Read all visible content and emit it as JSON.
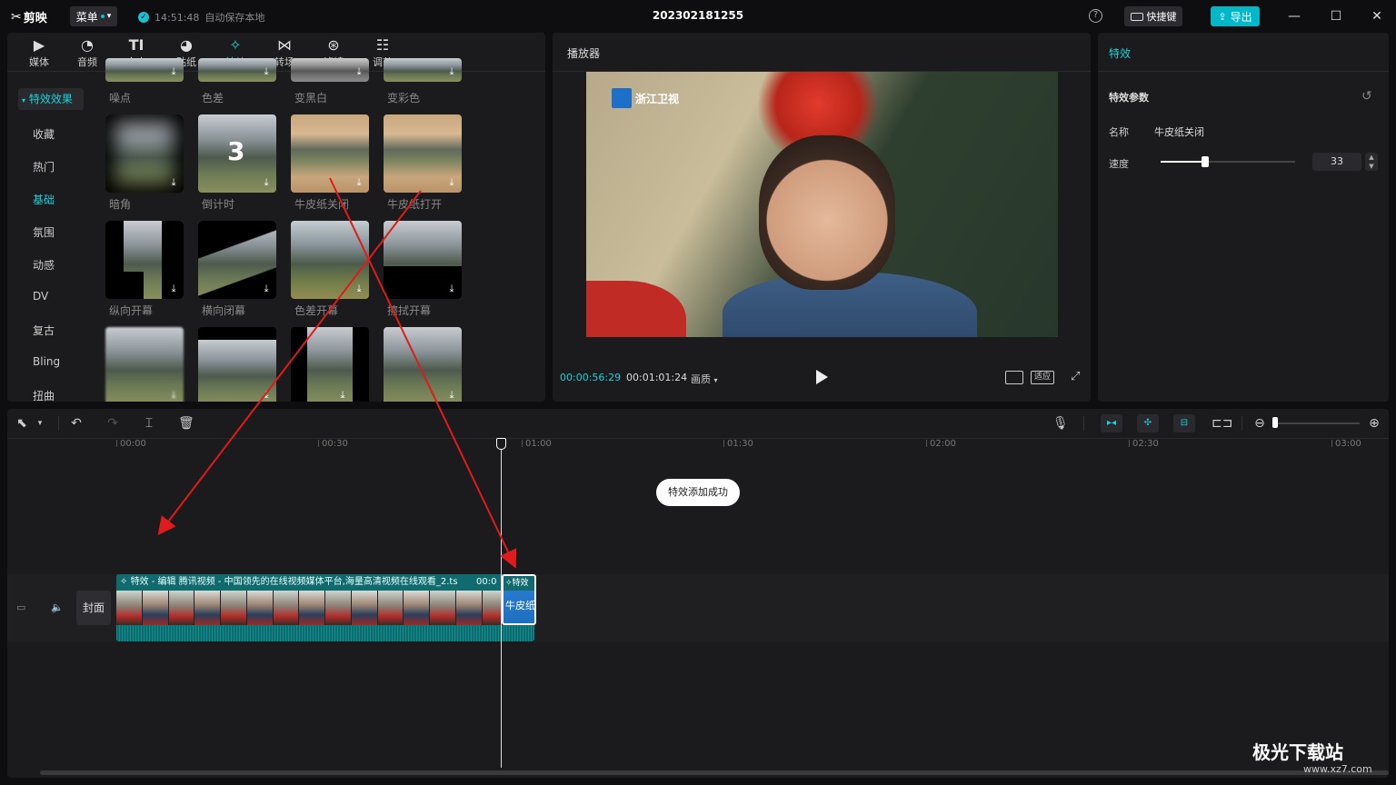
{
  "app": {
    "name": "剪映",
    "menu_label": "菜单",
    "save_time": "14:51:48",
    "save_status": "自动保存本地",
    "project_title": "202302181255",
    "shortcut_label": "快捷键",
    "export_label": "导出"
  },
  "tool_tabs": [
    {
      "label": "媒体",
      "icon": "media-icon"
    },
    {
      "label": "音频",
      "icon": "audio-icon"
    },
    {
      "label": "文本",
      "icon": "text-icon"
    },
    {
      "label": "贴纸",
      "icon": "sticker-icon"
    },
    {
      "label": "特效",
      "icon": "effects-icon",
      "active": true
    },
    {
      "label": "转场",
      "icon": "transition-icon"
    },
    {
      "label": "滤镜",
      "icon": "filter-icon"
    },
    {
      "label": "调节",
      "icon": "adjust-icon"
    }
  ],
  "categories": {
    "header": "特效效果",
    "items": [
      "收藏",
      "热门",
      "基础",
      "氛围",
      "动感",
      "DV",
      "复古",
      "Bling",
      "扭曲"
    ],
    "active": "基础"
  },
  "effects": {
    "row0": [
      "噪点",
      "色差",
      "变黑白",
      "变彩色"
    ],
    "row1": [
      "暗角",
      "倒计时",
      "牛皮纸关闭",
      "牛皮纸打开"
    ],
    "row2": [
      "纵向开幕",
      "横向闭幕",
      "色差开幕",
      "擦拭开幕"
    ],
    "countdown_digit": "3"
  },
  "player": {
    "title": "播放器",
    "current_time": "00:00:56:29",
    "total_time": "00:01:01:24",
    "quality_label": "画质",
    "ratio_label": "适应",
    "channel_logo": "浙江卫视"
  },
  "effect_panel": {
    "title": "特效",
    "section": "特效参数",
    "name_label": "名称",
    "name_value": "牛皮纸关闭",
    "speed_label": "速度",
    "speed_value": "33",
    "speed_fraction": 0.33
  },
  "timeline": {
    "ruler": [
      "00:00",
      "00:30",
      "01:00",
      "01:30",
      "02:00",
      "02:30",
      "03:00"
    ],
    "toast": "特效添加成功",
    "cover_label": "封面",
    "clip_header": "特效 - 编辑    腾讯视频 - 中国领先的在线视频媒体平台,海量高清视频在线观看_2.ts",
    "clip_time": "00:0",
    "fx_head": "特效",
    "fx_clip_label": "牛皮纸"
  },
  "watermark": {
    "title": "极光下载站",
    "url": "www.xz7.com"
  },
  "colors": {
    "accent": "#1ad1dc",
    "export": "#00b8c8",
    "arrow": "#e01b1b"
  }
}
